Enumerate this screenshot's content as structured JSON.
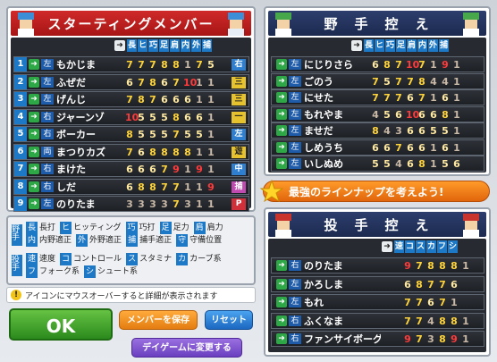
{
  "starting": {
    "title": "スターティングメンバー",
    "col_headers": [
      "長",
      "ヒ",
      "巧",
      "足",
      "肩",
      "内",
      "外",
      "捕"
    ],
    "players": [
      {
        "num": "1",
        "hand": "左",
        "name": "もかじま",
        "stats": [
          "7",
          "7",
          "7",
          "8",
          "8",
          "1",
          "7",
          "5"
        ],
        "pos": "右",
        "pos_color": "#2f7fd0"
      },
      {
        "num": "2",
        "hand": "左",
        "name": "ふぜだ",
        "stats": [
          "6",
          "7",
          "8",
          "6",
          "7",
          "10",
          "1",
          "1"
        ],
        "pos": "三",
        "pos_color": "#e6c22e"
      },
      {
        "num": "3",
        "hand": "左",
        "name": "げんじ",
        "stats": [
          "7",
          "8",
          "7",
          "6",
          "6",
          "6",
          "1",
          "1"
        ],
        "pos": "三",
        "pos_color": "#e6c22e"
      },
      {
        "num": "4",
        "hand": "右",
        "name": "ジャーンゾ",
        "stats": [
          "10",
          "5",
          "5",
          "5",
          "8",
          "6",
          "6",
          "1"
        ],
        "pos": "一",
        "pos_color": "#e6c22e"
      },
      {
        "num": "5",
        "hand": "右",
        "name": "ボーカー",
        "stats": [
          "8",
          "5",
          "5",
          "5",
          "7",
          "5",
          "5",
          "1"
        ],
        "pos": "左",
        "pos_color": "#2f7fd0"
      },
      {
        "num": "6",
        "hand": "両",
        "name": "まつりカズ",
        "stats": [
          "7",
          "6",
          "8",
          "8",
          "8",
          "8",
          "1",
          "1"
        ],
        "pos": "遊",
        "pos_color": "#e6c22e"
      },
      {
        "num": "7",
        "hand": "右",
        "name": "まけた",
        "stats": [
          "6",
          "6",
          "6",
          "7",
          "9",
          "1",
          "9",
          "1"
        ],
        "pos": "中",
        "pos_color": "#2f7fd0"
      },
      {
        "num": "8",
        "hand": "右",
        "name": "しだ",
        "stats": [
          "6",
          "8",
          "8",
          "7",
          "7",
          "1",
          "1",
          "9"
        ],
        "pos": "捕",
        "pos_color": "#c04ab0"
      },
      {
        "num": "9",
        "hand": "左",
        "name": "のりたま",
        "stats": [
          "3",
          "3",
          "3",
          "3",
          "7",
          "3",
          "1",
          "1"
        ],
        "pos": "P",
        "pos_color": "#d0303a"
      }
    ]
  },
  "legend": {
    "fielder_label": "野手",
    "items": [
      {
        "b": "長",
        "t": "長打"
      },
      {
        "b": "ヒ",
        "t": "ヒッティング"
      },
      {
        "b": "巧",
        "t": "巧打"
      },
      {
        "b": "足",
        "t": "足力"
      },
      {
        "b": "肩",
        "t": "肩力"
      },
      {
        "b": "内",
        "t": "内野適正"
      },
      {
        "b": "外",
        "t": "外野適正"
      },
      {
        "b": "捕",
        "t": "捕手適正"
      },
      {
        "b": "守",
        "t": "守備位置"
      }
    ],
    "pitcher_label": "投手",
    "p_items": [
      {
        "b": "速",
        "t": "速度"
      },
      {
        "b": "コ",
        "t": "コントロール"
      },
      {
        "b": "ス",
        "t": "スタミナ"
      },
      {
        "b": "カ",
        "t": "カーブ系"
      },
      {
        "b": "フ",
        "t": "フォーク系"
      },
      {
        "b": "シ",
        "t": "シュート系"
      }
    ]
  },
  "tip": "アイコンにマウスオーバーすると詳細が表示されます",
  "buttons": {
    "ok": "OK",
    "save": "メンバーを保存",
    "reset": "リセット",
    "day": "デイゲームに変更する"
  },
  "fielders": {
    "title": "野　手　控　え",
    "col_headers": [
      "長",
      "ヒ",
      "巧",
      "足",
      "肩",
      "内",
      "外",
      "捕"
    ],
    "players": [
      {
        "hand": "左",
        "name": "にじりさら",
        "stats": [
          "6",
          "8",
          "7",
          "10",
          "7",
          "1",
          "9",
          "1"
        ]
      },
      {
        "hand": "左",
        "name": "ごのう",
        "stats": [
          "7",
          "5",
          "7",
          "7",
          "8",
          "4",
          "4",
          "1"
        ]
      },
      {
        "hand": "左",
        "name": "にせた",
        "stats": [
          "7",
          "7",
          "7",
          "6",
          "7",
          "1",
          "6",
          "1"
        ]
      },
      {
        "hand": "左",
        "name": "もれやま",
        "stats": [
          "4",
          "5",
          "6",
          "10",
          "6",
          "6",
          "8",
          "1"
        ]
      },
      {
        "hand": "左",
        "name": "ませだ",
        "stats": [
          "8",
          "4",
          "3",
          "6",
          "6",
          "5",
          "5",
          "1"
        ]
      },
      {
        "hand": "左",
        "name": "しめうち",
        "stats": [
          "6",
          "6",
          "7",
          "6",
          "6",
          "1",
          "6",
          "1"
        ]
      },
      {
        "hand": "左",
        "name": "いしぬめ",
        "stats": [
          "5",
          "5",
          "4",
          "6",
          "8",
          "1",
          "5",
          "6"
        ]
      }
    ]
  },
  "banner": "最強のラインナップを考えよう!",
  "pitchers": {
    "title": "投　手　控　え",
    "col_headers": [
      "速",
      "コ",
      "ス",
      "カ",
      "フ",
      "シ"
    ],
    "players": [
      {
        "hand": "右",
        "name": "のりたま",
        "stats": [
          "9",
          "7",
          "8",
          "8",
          "8",
          "1"
        ]
      },
      {
        "hand": "左",
        "name": "かろしま",
        "stats": [
          "6",
          "8",
          "7",
          "7",
          "6",
          ""
        ]
      },
      {
        "hand": "左",
        "name": "もれ",
        "stats": [
          "7",
          "7",
          "6",
          "7",
          "1",
          ""
        ]
      },
      {
        "hand": "右",
        "name": "ふくなま",
        "stats": [
          "7",
          "7",
          "4",
          "8",
          "8",
          "1"
        ]
      },
      {
        "hand": "右",
        "name": "ファンサイボーグ",
        "stats": [
          "9",
          "7",
          "3",
          "8",
          "9",
          "1"
        ]
      }
    ]
  }
}
